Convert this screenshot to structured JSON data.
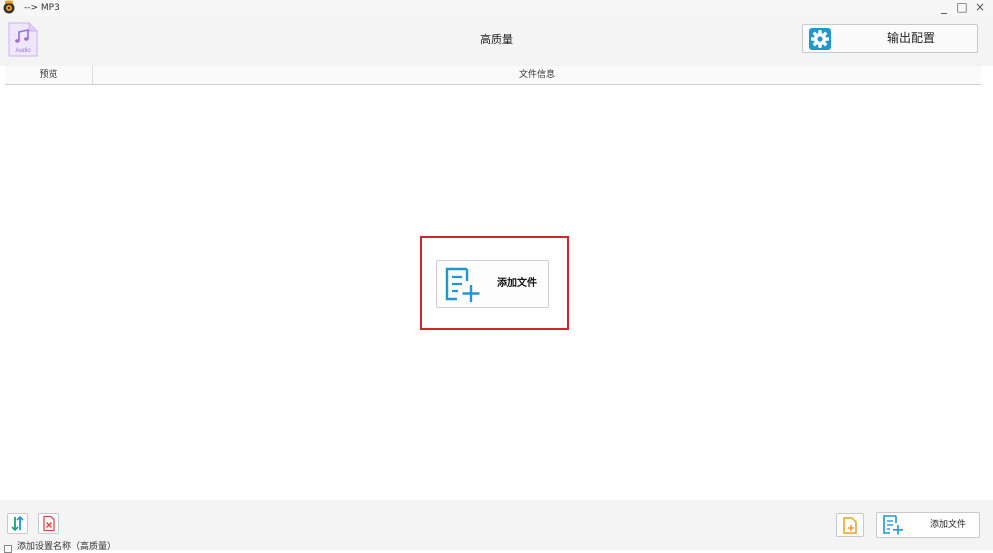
{
  "window": {
    "title": "--> MP3",
    "minimize_glyph": "_",
    "maximize_glyph": "□",
    "close_glyph": "×"
  },
  "toolbar": {
    "format_icon_label": "Audio",
    "quality_label": "高质量",
    "output_config_label": "输出配置"
  },
  "columns": {
    "preview": "预览",
    "file_info": "文件信息"
  },
  "main": {
    "add_file_label": "添加文件"
  },
  "bottom": {
    "add_file_label": "添加文件",
    "checkbox_label": "添加设置名称（高质量）"
  },
  "colors": {
    "accent_blue": "#2196d3",
    "purple": "#9a6fd6",
    "highlight_red": "#d0272e",
    "folder_orange": "#e9a21c",
    "delete_red": "#e04848",
    "sort_green": "#1aa36b"
  }
}
